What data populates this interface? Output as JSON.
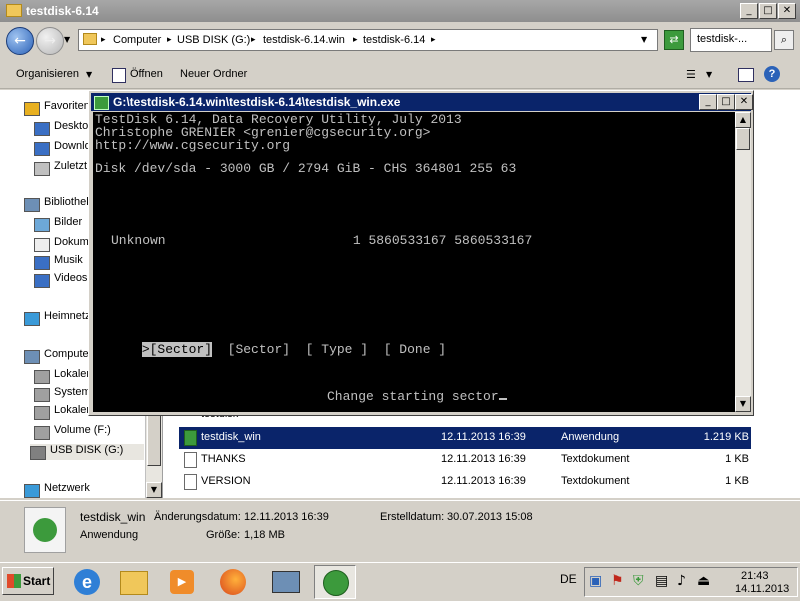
{
  "explorer": {
    "title": "testdisk-6.14",
    "breadcrumbs": [
      "Computer",
      "USB DISK (G:)",
      "testdisk-6.14.win",
      "testdisk-6.14"
    ],
    "search_placeholder": "testdisk-...",
    "toolbar": {
      "organize": "Organisieren",
      "open": "Öffnen",
      "new_folder": "Neuer Ordner"
    },
    "nav": [
      {
        "label": "Favoriten",
        "icon": "star-icon"
      },
      {
        "label": "Desktop",
        "icon": "desktop-icon"
      },
      {
        "label": "Downloads",
        "icon": "downloads-icon"
      },
      {
        "label": "Zuletzt",
        "icon": "recent-icon"
      },
      {
        "label": "Bibliotheken",
        "icon": "library-icon"
      },
      {
        "label": "Bilder",
        "icon": "pictures-icon"
      },
      {
        "label": "Dokumente",
        "icon": "documents-icon"
      },
      {
        "label": "Musik",
        "icon": "music-icon"
      },
      {
        "label": "Videos",
        "icon": "videos-icon"
      },
      {
        "label": "Heimnetz",
        "icon": "homegroup-icon"
      },
      {
        "label": "Computer",
        "icon": "computer-icon"
      },
      {
        "label": "Lokaler",
        "icon": "drive-icon"
      },
      {
        "label": "System",
        "icon": "drive-icon"
      },
      {
        "label": "Lokaler",
        "icon": "drive-icon"
      },
      {
        "label": "Volume (F:)",
        "icon": "drive-icon"
      },
      {
        "label": "USB DISK (G:)",
        "icon": "usb-drive-icon"
      },
      {
        "label": "Netzwerk",
        "icon": "network-icon"
      }
    ],
    "files": [
      {
        "name": "testdisk_win",
        "date": "12.11.2013 16:39",
        "type": "Anwendung",
        "size": "1.219 KB",
        "selected": true
      },
      {
        "name": "THANKS",
        "date": "12.11.2013 16:39",
        "type": "Textdokument",
        "size": "1 KB",
        "selected": false
      },
      {
        "name": "VERSION",
        "date": "12.11.2013 16:39",
        "type": "Textdokument",
        "size": "1 KB",
        "selected": false
      }
    ],
    "details": {
      "name": "testdisk_win",
      "modified_label": "Änderungsdatum:",
      "modified": "12.11.2013 16:39",
      "created_label": "Erstelldatum:",
      "created": "30.07.2013 15:08",
      "type": "Anwendung",
      "size_label": "Größe:",
      "size": "1,18 MB"
    }
  },
  "console": {
    "title": "G:\\testdisk-6.14.win\\testdisk-6.14\\testdisk_win.exe",
    "line1": "TestDisk 6.14, Data Recovery Utility, July 2013",
    "line2": "Christophe GRENIER <grenier@cgsecurity.org>",
    "line3": "http://www.cgsecurity.org",
    "disk": "Disk /dev/sda - 3000 GB / 2794 GiB - CHS 364801 255 63",
    "partition": "Unknown                        1 5860533167 5860533167",
    "menu_sel": ">[Sector]",
    "menu_sector": "[Sector]",
    "menu_type": "[ Type ]",
    "menu_done": "[ Done ]",
    "prompt": "Change starting sector"
  },
  "taskbar": {
    "start": "Start",
    "lang": "DE",
    "time": "21:43",
    "date": "14.11.2013"
  },
  "colors": {
    "console_bg": "#000000",
    "console_fg": "#c0c0c0",
    "titlebar_active": "#0a246a",
    "selection": "#0a246a"
  }
}
